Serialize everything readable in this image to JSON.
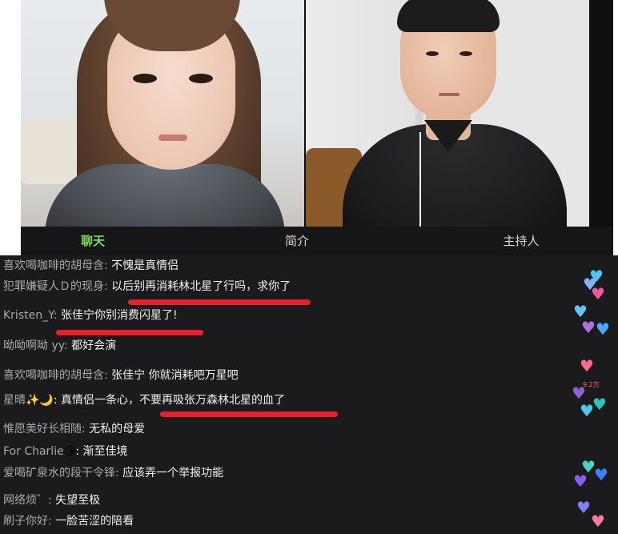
{
  "tabs": [
    {
      "label": "聊天",
      "active": true
    },
    {
      "label": "简介",
      "active": false
    },
    {
      "label": "主持人",
      "active": false
    }
  ],
  "chat": {
    "messages": [
      {
        "user": "喜欢喝咖啡的胡母含: ",
        "text": "不愧是真情侣"
      },
      {
        "user": "犯罪嫌疑人Ｄ的现身: ",
        "text": "以后别再消耗林北星了行吗，求你了"
      },
      {
        "user": "Kristen_Y: ",
        "text": "张佳宁你别消费闪星了!"
      },
      {
        "user": "呦呦啊呦 yy: ",
        "text": "都好会演"
      },
      {
        "user": "喜欢喝咖啡的胡母含: ",
        "text": "张佳宁 你就消耗吧万星吧"
      },
      {
        "user": "星晴",
        "emoji": "✨🌙",
        "text": ": 真情侣一条心，不要再吸张万森林北星的血了"
      },
      {
        "user": "惟愿美好长相随: ",
        "text": "无私的母爱"
      },
      {
        "user": "For Charlie",
        "emoji": "😘",
        "text": ": 渐至佳境"
      },
      {
        "user": "爱喝矿泉水的段干令锋: ",
        "text": "应该弄一个举报功能"
      },
      {
        "user": "网络烦゛: ",
        "text": "失望至极"
      },
      {
        "user": "刷子你好: ",
        "text": "一脸苦涩的陪看"
      }
    ],
    "like_badge": "9.2万"
  },
  "colors": {
    "tab_active": "#7ed957",
    "chat_bg": "#1b1b1d",
    "underline": "#e8202a"
  }
}
